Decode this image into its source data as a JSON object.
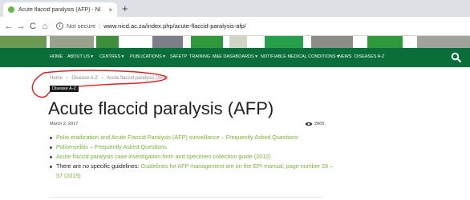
{
  "browser": {
    "tab_title": "Acute flaccid paralysis (AFP) - NI",
    "tab_close": "×",
    "new_tab": "+",
    "back": "←",
    "forward": "→",
    "reload": "C",
    "home": "⌂",
    "security_label": "Not secure",
    "url": "www.nicd.ac.za/index.php/acute-flaccid-paralysis-afp/"
  },
  "nav": {
    "items": [
      "HOME",
      "ABOUT US ▾",
      "CENTRES ▾",
      "PUBLICATIONS ▾",
      "SAFETP",
      "TRAINING",
      "M&E DASHBOARDS ▾",
      "NOTIFIABLE MEDICAL CONDITIONS ▾",
      "NEWS",
      "DISEASES A-Z"
    ],
    "search_icon": "search-icon"
  },
  "breadcrumb": {
    "home": "Home",
    "sep": "›",
    "level2": "Disease A-Z",
    "current": "Acute flaccid paralysis (AFP)"
  },
  "category_tag": "Disease A-Z",
  "page_title": "Acute flaccid paralysis (AFP)",
  "date": "March 2, 2017",
  "views": "2869",
  "links": [
    {
      "text": "Polio eradication and Acute Flaccid Paralysis (AFP) surveillance – Frequently Asked Questions"
    },
    {
      "text": "Poliomyelitis – Frequently Asked Questions"
    },
    {
      "text": "Acute flaccid paralysis case investigation form and specimen collection guide (2012)"
    }
  ],
  "last_item": {
    "prefix": "There are no specific guidelines: ",
    "link": "Guidelines for AFP management are on the EPI manual, page number 28 – 57 (2015)"
  },
  "colors": {
    "nav_green": "#0a6e3a",
    "link_green": "#7ab338",
    "annotation_red": "#e02020"
  }
}
